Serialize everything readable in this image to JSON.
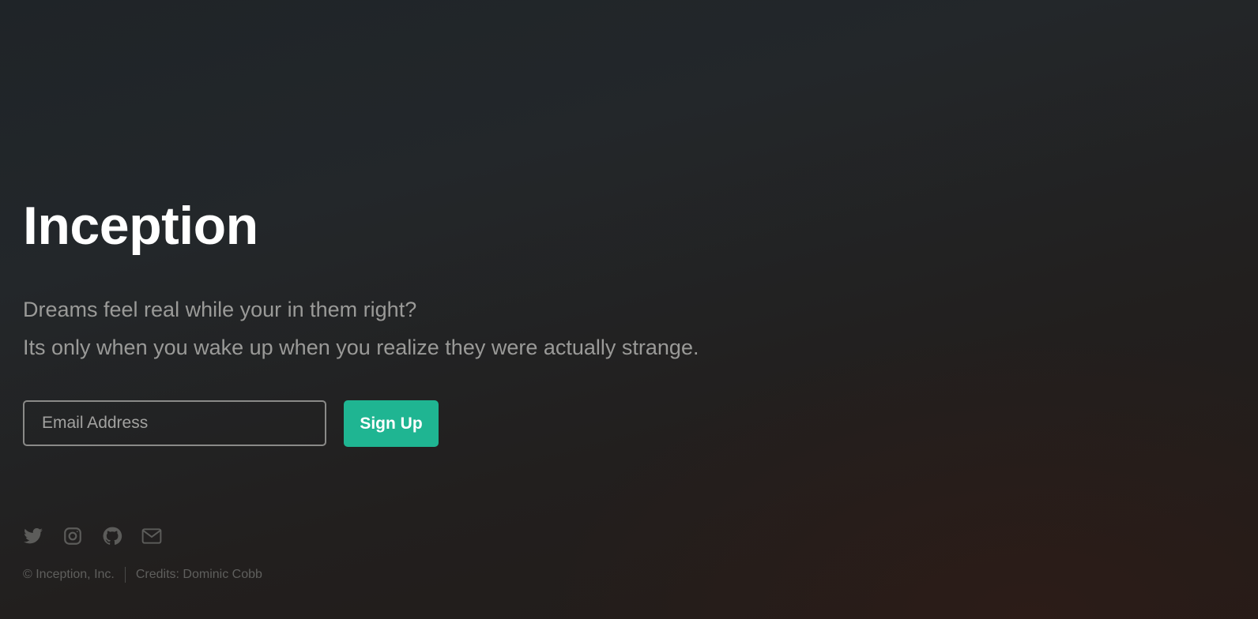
{
  "hero": {
    "title": "Inception",
    "tagline_line1": "Dreams feel real while your in them right?",
    "tagline_line2": "Its only when you wake up when you realize they were actually strange."
  },
  "signup_form": {
    "email_placeholder": "Email Address",
    "email_value": "",
    "button_label": "Sign Up"
  },
  "social_links": [
    {
      "icon": "twitter-icon"
    },
    {
      "icon": "instagram-icon"
    },
    {
      "icon": "github-icon"
    },
    {
      "icon": "mail-icon"
    }
  ],
  "footer": {
    "copyright": "© Inception, Inc.",
    "credits": "Credits: Dominic Cobb"
  },
  "colors": {
    "accent": "#1fb592",
    "background": "#222426",
    "muted_text": "#9a9a98"
  }
}
